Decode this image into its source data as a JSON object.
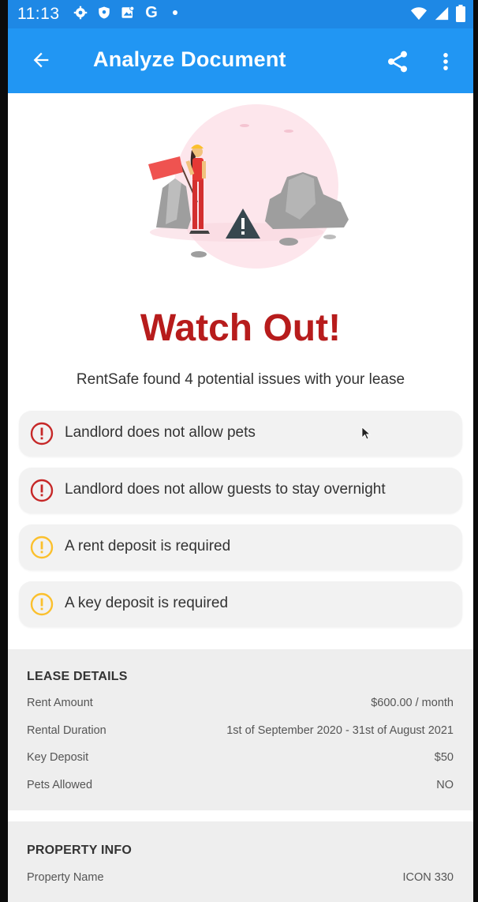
{
  "status_bar": {
    "time": "11:13",
    "icons_left": [
      "settings-icon",
      "shield-icon",
      "gallery-icon",
      "google-g-icon",
      "dot-icon"
    ],
    "g_label": "G",
    "icons_right": [
      "wifi-icon",
      "signal-icon",
      "battery-icon"
    ]
  },
  "app_bar": {
    "title": "Analyze Document",
    "back_icon": "arrow-back-icon",
    "share_icon": "share-icon",
    "more_icon": "more-vert-icon"
  },
  "colors": {
    "primary": "#2196f3",
    "primary_dark": "#1e88e5",
    "headline_red": "#b71c1c",
    "error_icon": "#c62828",
    "warning_icon": "#fbc02d"
  },
  "hero": {
    "illustration": "construction-worker-warning-illustration",
    "headline": "Watch Out!",
    "subtitle": "RentSafe found 4 potential issues with your lease"
  },
  "issues": [
    {
      "text": "Landlord does not allow pets",
      "severity": "error"
    },
    {
      "text": "Landlord does not allow guests to stay overnight",
      "severity": "error"
    },
    {
      "text": "A rent deposit is required",
      "severity": "warning"
    },
    {
      "text": "A key deposit is required",
      "severity": "warning"
    }
  ],
  "lease_details": {
    "title": "LEASE DETAILS",
    "rows": [
      {
        "label": "Rent Amount",
        "value": "$600.00 / month"
      },
      {
        "label": "Rental Duration",
        "value": "1st of September 2020 - 31st of August 2021"
      },
      {
        "label": "Key Deposit",
        "value": "$50"
      },
      {
        "label": "Pets Allowed",
        "value": "NO"
      }
    ]
  },
  "property_info": {
    "title": "PROPERTY INFO",
    "rows": [
      {
        "label": "Property Name",
        "value": "ICON 330"
      }
    ]
  }
}
